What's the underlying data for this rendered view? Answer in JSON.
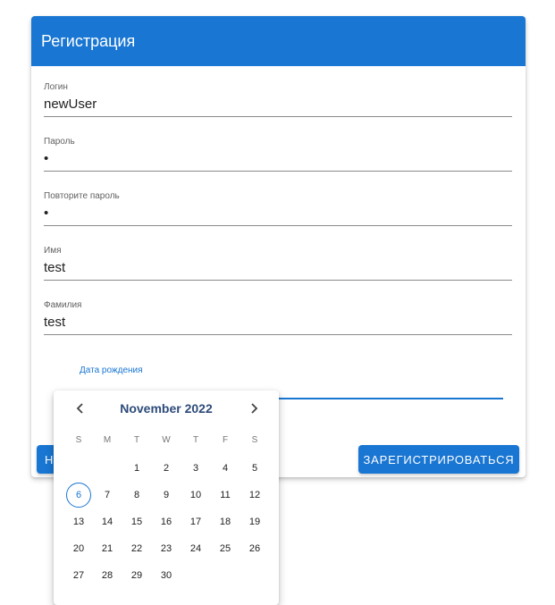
{
  "form": {
    "title": "Регистрация",
    "fields": [
      {
        "label": "Логин",
        "value": "newUser"
      },
      {
        "label": "Пароль",
        "value": "•"
      },
      {
        "label": "Повторите пароль",
        "value": "•"
      },
      {
        "label": "Имя",
        "value": "test"
      },
      {
        "label": "Фамилия",
        "value": "test"
      }
    ],
    "date_field": {
      "label": "Дата рождения",
      "icon": "calendar-icon"
    },
    "left_button_label": "Н",
    "submit_label": "ЗАРЕГИСТРИРОВАТЬСЯ"
  },
  "datepicker": {
    "month_label": "November 2022",
    "prev_icon": "chevron-left-icon",
    "next_icon": "chevron-right-icon",
    "weekdays": [
      "S",
      "M",
      "T",
      "W",
      "T",
      "F",
      "S"
    ],
    "first_weekday_index": 2,
    "days": [
      "1",
      "2",
      "3",
      "4",
      "5",
      "6",
      "7",
      "8",
      "9",
      "10",
      "11",
      "12",
      "13",
      "14",
      "15",
      "16",
      "17",
      "18",
      "19",
      "20",
      "21",
      "22",
      "23",
      "24",
      "25",
      "26",
      "27",
      "28",
      "29",
      "30"
    ],
    "today": "6",
    "accent": "#1976d2"
  }
}
